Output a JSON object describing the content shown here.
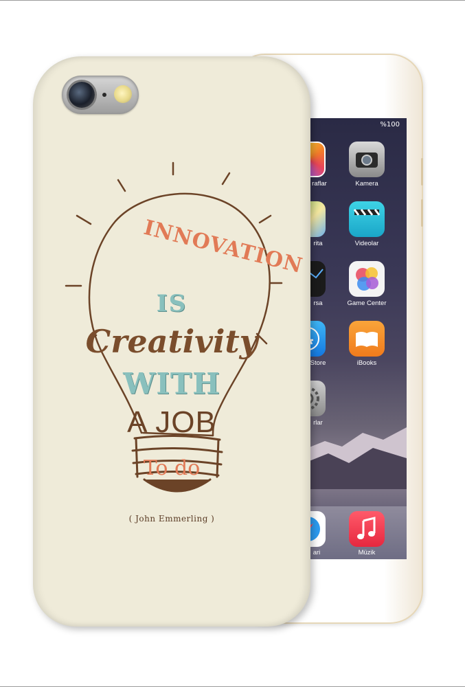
{
  "phone": {
    "status": "%100",
    "apps": [
      {
        "label": "raflar",
        "icon": "photos-icon"
      },
      {
        "label": "Kamera",
        "icon": "camera-icon"
      },
      {
        "label": "rita",
        "icon": "maps-icon"
      },
      {
        "label": "Videolar",
        "icon": "videos-icon"
      },
      {
        "label": "rsa",
        "icon": "stocks-icon"
      },
      {
        "label": "Game Center",
        "icon": "game-center-icon"
      },
      {
        "label": "Store",
        "icon": "app-store-icon"
      },
      {
        "label": "iBooks",
        "icon": "ibooks-icon"
      },
      {
        "label": "rlar",
        "icon": "settings-icon"
      }
    ],
    "dock": [
      {
        "label": "ari",
        "icon": "safari-icon"
      },
      {
        "label": "Müzik",
        "icon": "music-icon"
      }
    ]
  },
  "case": {
    "quote": {
      "line1": "INNOVATION",
      "line2": "IS",
      "line3": "Creativity",
      "line4": "WITH",
      "line5": "A JOB",
      "line6": "To do"
    },
    "author": "( John Emmerling )",
    "colors": {
      "background": "#efebd9",
      "orange": "#e17a56",
      "teal": "#89c0bd",
      "brown": "#7a4d2c"
    }
  }
}
